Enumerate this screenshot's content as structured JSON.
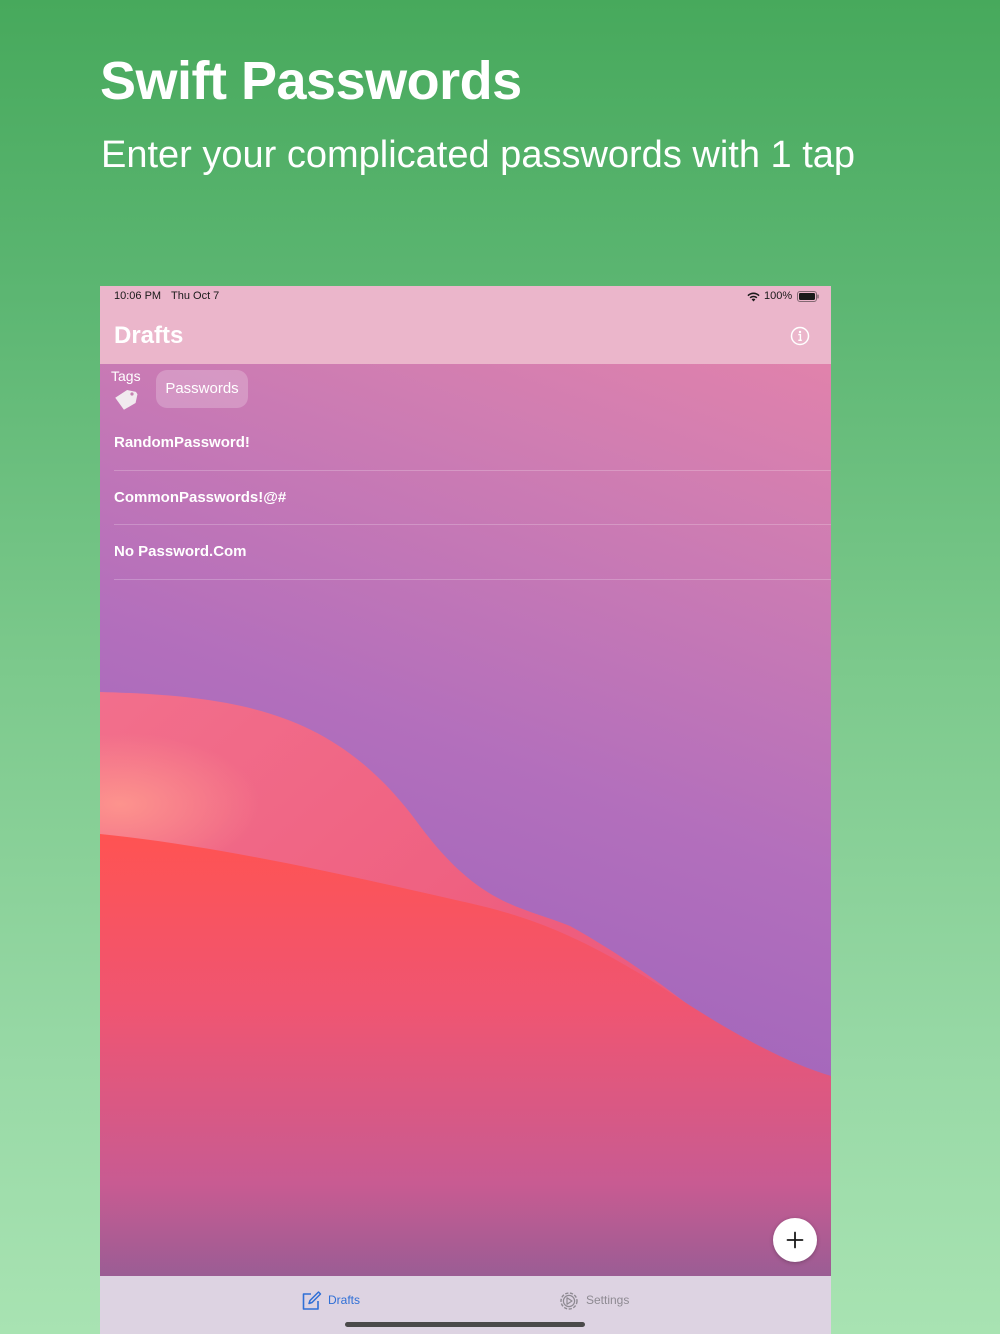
{
  "hero": {
    "title": "Swift Passwords",
    "subtitle": "Enter your complicated passwords with 1 tap"
  },
  "status_bar": {
    "time": "10:06 PM",
    "date": "Thu Oct 7",
    "battery": "100%",
    "wifi_icon": "wifi-icon",
    "battery_icon": "battery-icon"
  },
  "nav": {
    "title": "Drafts",
    "info_icon": "info-icon"
  },
  "tags": {
    "label": "Tags",
    "icon": "tag-icon",
    "chips": [
      "Passwords"
    ]
  },
  "drafts": [
    "RandomPassword!",
    "CommonPasswords!@#",
    "No Password.Com"
  ],
  "fab": {
    "icon": "plus-icon"
  },
  "tab_bar": {
    "tabs": [
      {
        "label": "Drafts",
        "icon": "compose-icon",
        "selected": true
      },
      {
        "label": "Settings",
        "icon": "gear-icon",
        "selected": false
      }
    ]
  },
  "colors": {
    "page_background_top": "#47a95c",
    "page_background_bottom": "#a8e3b2",
    "nav_bar": "#ebb6cb",
    "selected_tab": "#2f6fd6",
    "unselected_tab": "#8e8a92"
  }
}
